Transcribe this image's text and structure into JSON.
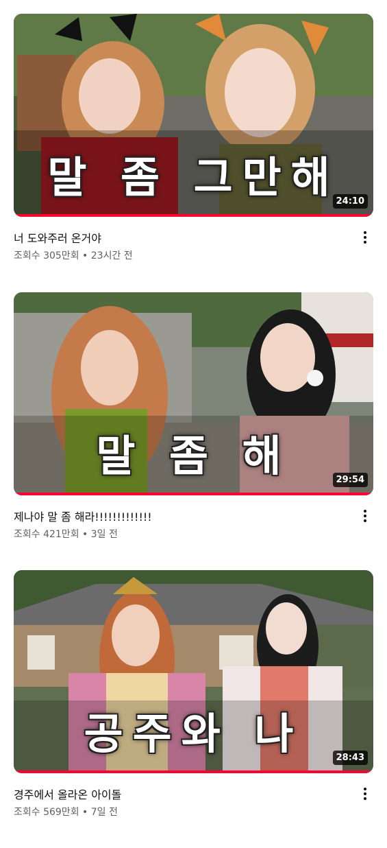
{
  "videos": [
    {
      "caption": "말 좀 그만해",
      "duration": "24:10",
      "progress": 1.0,
      "title": "너 도와주러 온거야",
      "views": "조회수 305만회",
      "separator": "•",
      "age": "23시간 전",
      "icon": "more-vert-icon"
    },
    {
      "caption": "말 좀 해",
      "duration": "29:54",
      "progress": 1.0,
      "title": "제나야 말 좀 해라!!!!!!!!!!!!!",
      "views": "조회수 421만회",
      "separator": "•",
      "age": "3일 전",
      "icon": "more-vert-icon"
    },
    {
      "caption": "공주와 나",
      "duration": "28:43",
      "progress": 1.0,
      "title": "경주에서 올라온 아이돌",
      "views": "조회수 569만회",
      "separator": "•",
      "age": "7일 전",
      "icon": "more-vert-icon"
    }
  ],
  "colors": {
    "progress": "#ff0033",
    "meta_text": "#606060",
    "title_text": "#0f0f0f"
  }
}
